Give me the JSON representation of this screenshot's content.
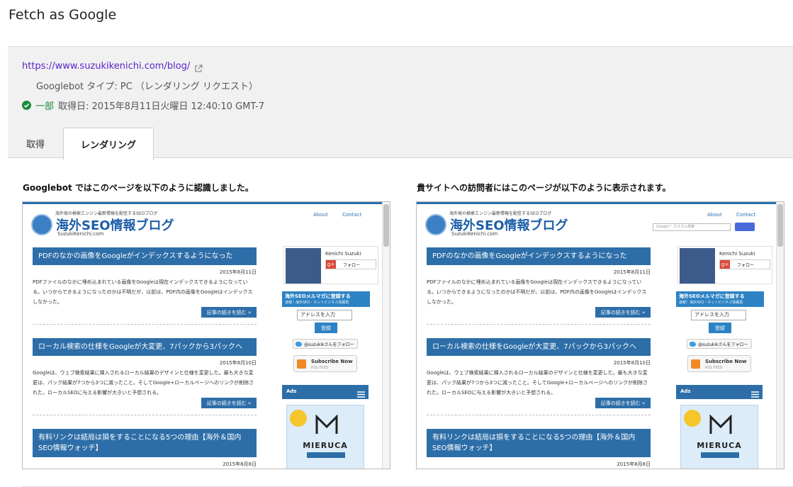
{
  "page": {
    "title": "Fetch as Google"
  },
  "fetch": {
    "url": "https://www.suzukikenichi.com/blog/",
    "googlebot_type": "Googlebot タイプ: PC （レンダリング リクエスト）",
    "status": "一部",
    "fetch_date": "取得日: 2015年8月11日火曜日 12:40:10 GMT-7"
  },
  "tabs": [
    {
      "label": "取得",
      "active": false
    },
    {
      "label": "レンダリング",
      "active": true
    }
  ],
  "headings": {
    "googlebot": "Googlebot ではこのページを以下のように認識しました。",
    "visitor": "貴サイトへの訪問者にはこのページが以下のように表示されます。"
  },
  "site": {
    "tagline": "海外発の検索エンジン最新情報を配信するSEOブログ",
    "title": "海外SEO情報ブログ",
    "domain": "SuzukiKenichi.com",
    "nav_about": "About",
    "nav_contact": "Contact",
    "search_placeholder": "Google™ カスタム検索"
  },
  "posts": [
    {
      "title": "PDFのなかの画像をGoogleがインデックスするようになった",
      "date": "2015年8月11日",
      "body": "PDFファイルのなかに埋め込まれている画像をGoogleは現在インデックスできるようになっている。いつからできるようになったのかは不明だが、以前は、PDF内の画像をGoogleはインデックスしなかった。",
      "more": "記事の続きを読む »"
    },
    {
      "title": "ローカル検索の仕様をGoogleが大変更、7パックから3パックへ",
      "date": "2015年8月10日",
      "body": "Googleは、ウェブ検索結果に挿入されるローカル結果のデザインと仕様を変更した。最も大きな変更は、パック結果が7つから3つに減ったこと。そしてGoogle+ローカルページへのリンクが削除された。ローカルSEOに与える影響が大きいと予想される。",
      "more": "記事の続きを読む »"
    },
    {
      "title": "有料リンクは結局は損をすることになる5つの理由【海外＆国内SEO情報ウォッチ】",
      "date": "2015年8月8日",
      "body": "",
      "more": ""
    }
  ],
  "sidebar": {
    "profile_name": "Kenichi Suzuki",
    "follow_label": "フォロー",
    "gplus_glyph": "g+",
    "mag_title": "海外SEOメルマガに登録する",
    "mag_sub": "速報！海外SEO・ネットビジネス情報局",
    "email_value": "アドレスを入力",
    "register_label": "登録",
    "twitter_label": "@suzukikさんをフォロー",
    "rss_title": "Subscribe Now",
    "rss_sub": "RSS FEED",
    "ads_label": "Ads",
    "ads_brand": "MIERUCA"
  },
  "colors": {
    "link": "#5a22c9",
    "success": "#1b8a3a",
    "site_blue": "#2d6ea8"
  }
}
